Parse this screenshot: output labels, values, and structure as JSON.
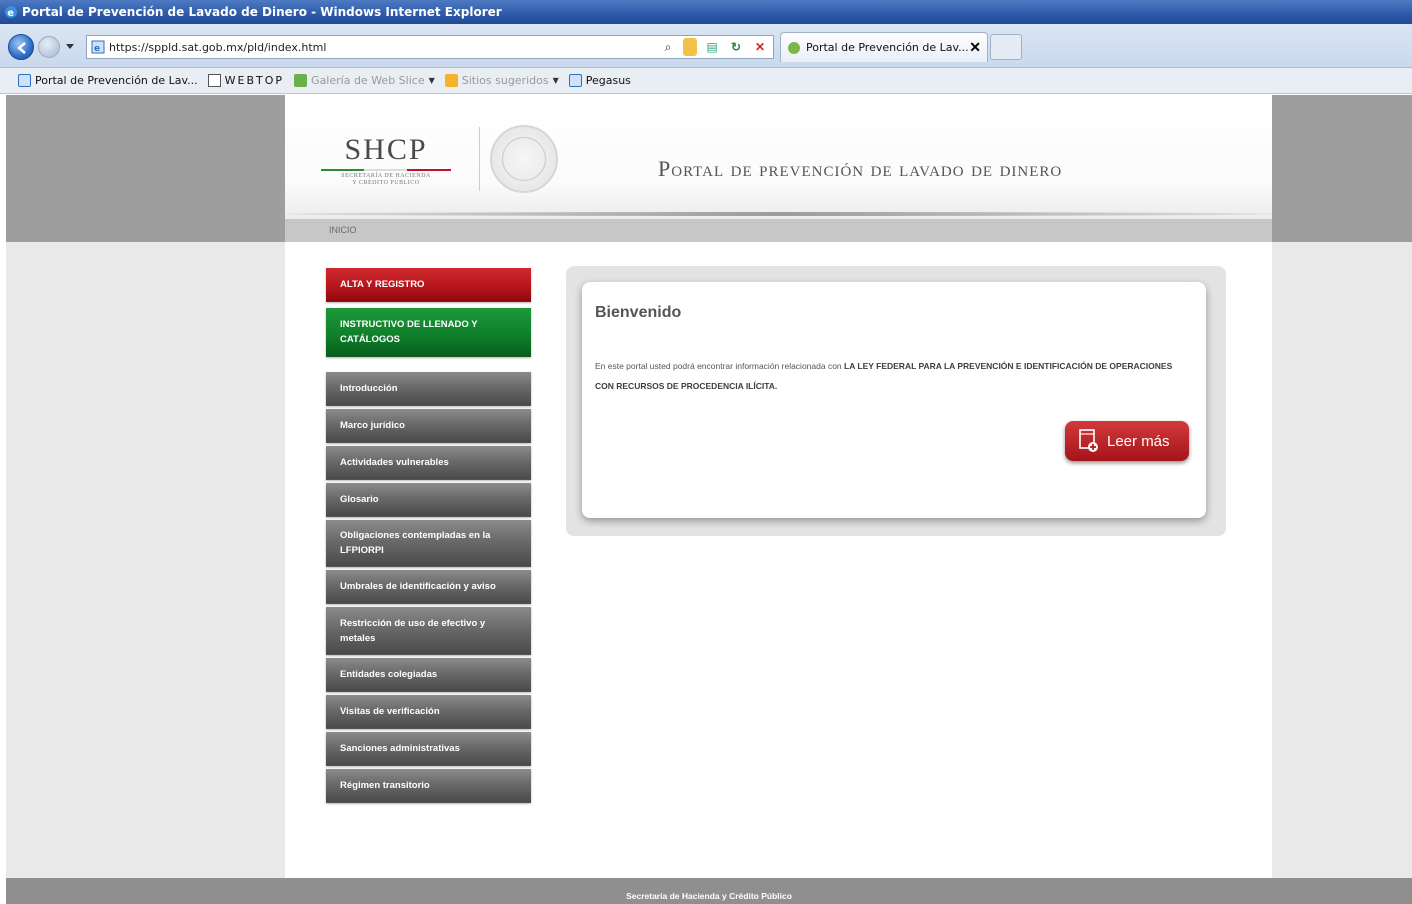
{
  "window": {
    "title": "Portal de Prevención de Lavado de Dinero - Windows Internet Explorer"
  },
  "address": {
    "url": "https://sppld.sat.gob.mx/pld/index.html"
  },
  "tab": {
    "label": "Portal de Prevención de Lav..."
  },
  "favorites": {
    "items": [
      {
        "label": "Portal de Prevención de Lav..."
      },
      {
        "label": "WEBTOP"
      },
      {
        "label": "Galería de Web Slice"
      },
      {
        "label": "Sitios sugeridos"
      },
      {
        "label": "Pegasus"
      }
    ]
  },
  "header": {
    "logo_text": "SHCP",
    "logo_sub1": "SECRETARÍA DE HACIENDA",
    "logo_sub2": "Y CRÉDITO PÚBLICO",
    "portal_title": "Portal de prevención de lavado de dinero",
    "breadcrumb": "INICIO"
  },
  "sidebar": {
    "items": [
      {
        "label": "ALTA Y REGISTRO"
      },
      {
        "label": "INSTRUCTIVO DE LLENADO Y CATÁLOGOS"
      },
      {
        "label": "Introducción"
      },
      {
        "label": "Marco jurídico"
      },
      {
        "label": "Actividades vulnerables"
      },
      {
        "label": "Glosario"
      },
      {
        "label": "Obligaciones contempladas en la LFPIORPI"
      },
      {
        "label": "Umbrales de identificación y aviso"
      },
      {
        "label": "Restricción de uso de efectivo y metales"
      },
      {
        "label": "Entidades colegiadas"
      },
      {
        "label": "Visitas de verificación"
      },
      {
        "label": "Sanciones administrativas"
      },
      {
        "label": "Régimen transitorio"
      }
    ]
  },
  "welcome": {
    "title": "Bienvenido",
    "intro": "En este portal usted podrá encontrar información relacionada con ",
    "law": "LA LEY FEDERAL PARA LA PREVENCIÓN E IDENTIFICACIÓN DE OPERACIONES CON RECURSOS DE PROCEDENCIA ILÍCITA.",
    "read_more": "Leer más"
  },
  "footer": {
    "text": "Secretaría de Hacienda y Crédito Público"
  }
}
